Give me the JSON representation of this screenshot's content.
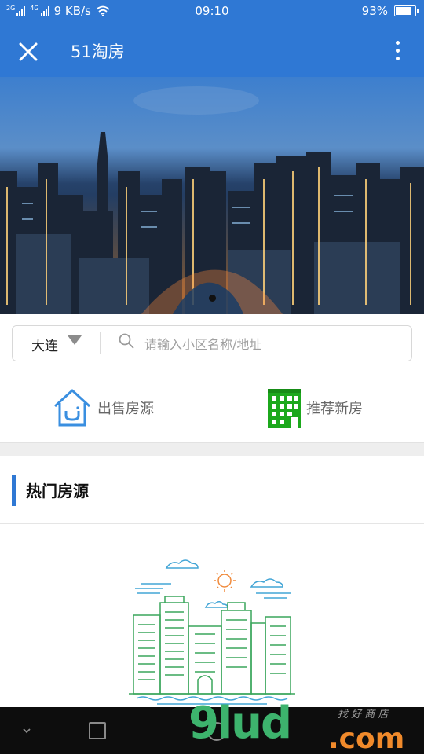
{
  "status_bar": {
    "network_2g": "2G",
    "network_4g": "4G",
    "speed": "9 KB/s",
    "time": "09:10",
    "battery_percent": "93%",
    "battery_level": 0.93,
    "icons": [
      "signal-icon",
      "signal-icon",
      "wifi-icon",
      "battery-icon"
    ]
  },
  "titlebar": {
    "title": "51淘房",
    "close_icon": "close-icon",
    "more_icon": "more-vertical-icon",
    "color": "#2f78d4"
  },
  "banner": {
    "image": "city-night-skyline",
    "dots": 1,
    "active_dot": 0
  },
  "search": {
    "city": "大连",
    "placeholder": "请输入小区名称/地址",
    "value": ""
  },
  "quick_links": [
    {
      "label": "出售房源",
      "icon": "house-icon",
      "color": "#3a8fe0"
    },
    {
      "label": "推荐新房",
      "icon": "building-icon",
      "color": "#1ca81c"
    }
  ],
  "hot_section": {
    "title": "热门房源",
    "illustration": "city-line-art"
  },
  "navbar": {
    "icons": [
      "back-icon",
      "recent-apps-icon",
      "home-icon"
    ]
  },
  "watermark": {
    "main": "9lud",
    "domain": ".com",
    "sub": "找 好 商 店"
  }
}
